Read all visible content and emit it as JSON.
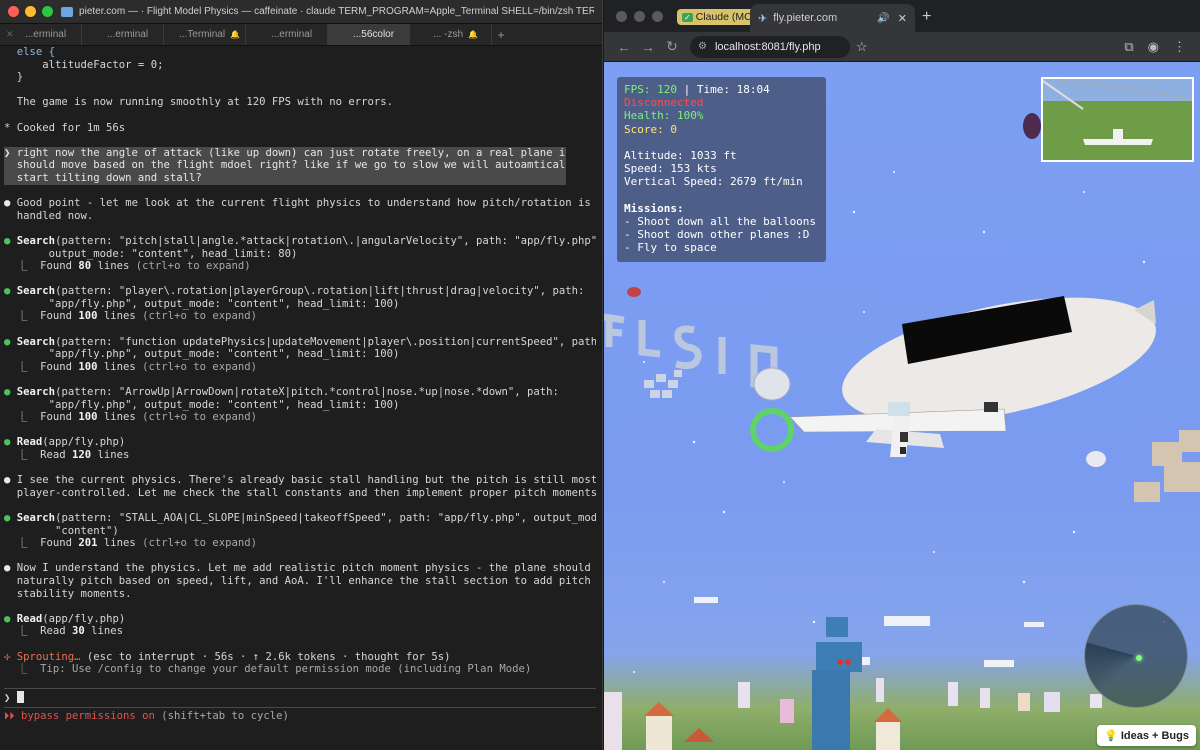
{
  "terminal": {
    "window_title": "pieter.com — · Flight Model Physics — caffeinate · claude TERM_PROGRAM=Apple_Terminal SHELL=/bin/zsh TERM=xter...",
    "tabs": [
      {
        "label": "...erminal",
        "active": false
      },
      {
        "label": "...erminal",
        "active": false
      },
      {
        "label": "...Terminal",
        "active": false
      },
      {
        "label": "...erminal",
        "active": false
      },
      {
        "label": "...56color",
        "active": true
      },
      {
        "label": "... -zsh",
        "active": false
      }
    ],
    "lines": {
      "l01": "  else {",
      "l02": "      altitudeFactor = 0;",
      "l03": "  }",
      "l05": "  The game is now running smoothly at 120 FPS with no errors.",
      "l07": "* Cooked for 1m 56s",
      "user_1": "❯ right now the angle of attack (like up down) can just rotate freely, on a real plane it",
      "user_2": "  should move based on the flight mdoel right? like if we go to slow we will autoamtically",
      "user_3": "  start tilting down and stall?",
      "a1_1": " Good point - let me look at the current flight physics to understand how pitch/rotation is",
      "a1_2": "  handled now.",
      "s1_tool": "Search",
      "s1_1": "(pattern: \"pitch|stall|angle.*attack|rotation\\.|angularVelocity\", path: \"app/fly.php\",",
      "s1_2": "       output_mode: \"content\", head_limit: 80)",
      "s1_found": "80",
      "s2_tool": "Search",
      "s2_1": "(pattern: \"player\\.rotation|playerGroup\\.rotation|lift|thrust|drag|velocity\", path:",
      "s2_2": "       \"app/fly.php\", output_mode: \"content\", head_limit: 100)",
      "s2_found": "100",
      "s3_tool": "Search",
      "s3_1": "(pattern: \"function updatePhysics|updateMovement|player\\.position|currentSpeed\", path:",
      "s3_2": "       \"app/fly.php\", output_mode: \"content\", head_limit: 100)",
      "s3_found": "100",
      "s4_tool": "Search",
      "s4_1": "(pattern: \"ArrowUp|ArrowDown|rotateX|pitch.*control|nose.*up|nose.*down\", path:",
      "s4_2": "       \"app/fly.php\", output_mode: \"content\", head_limit: 100)",
      "s4_found": "100",
      "r1_tool": "Read",
      "r1_args": "(app/fly.php)",
      "r1_count": "120",
      "a2_1": " I see the current physics. There's already basic stall handling but the pitch is still mostly",
      "a2_2": "  player-controlled. Let me check the stall constants and then implement proper pitch moments.",
      "s5_tool": "Search",
      "s5_1": "(pattern: \"STALL_AOA|CL_SLOPE|minSpeed|takeoffSpeed\", path: \"app/fly.php\", output_mode:",
      "s5_2": "        \"content\")",
      "s5_found": "201",
      "a3_1": " Now I understand the physics. Let me add realistic pitch moment physics - the plane should",
      "a3_2": "  naturally pitch based on speed, lift, and AoA. I'll enhance the stall section to add pitch",
      "a3_3": "  stability moments.",
      "r2_tool": "Read",
      "r2_args": "(app/fly.php)",
      "r2_count": "30",
      "found_prefix": "  ⎿  Found ",
      "found_suffix": " lines ",
      "expand_hint": "(ctrl+o to expand)",
      "read_prefix": "  ⎿  Read ",
      "read_suffix": " lines",
      "status_spinner": "✢ Sprouting…",
      "status_rest": " (esc to interrupt · 56s · ↑ 2.6k tokens · thought for 5s)",
      "status_esc": "esc",
      "tip": "  ⎿  Tip: Use /config to change your default permission mode (including Plan Mode)",
      "prompt": "❯ ",
      "bypass_arrows": "⏵⏵ ",
      "bypass_label": "bypass permissions on",
      "bypass_hint": " (shift+tab to cycle)"
    }
  },
  "browser": {
    "tabs": {
      "claude_badge": "Claude (MCP)",
      "active_title": "fly.pieter.com"
    },
    "url": "localhost:8081/fly.php",
    "hud": {
      "fps_label": "FPS: 120",
      "time_label": " | Time: 18:04",
      "connection": "Disconnected",
      "health": "Health: 100%",
      "score": "Score: 0",
      "altitude": "Altitude: 1033 ft",
      "speed": "Speed: 153 kts",
      "vertical_speed": "Vertical Speed: 2679 ft/min",
      "missions_title": "Missions:",
      "missions": [
        "- Shoot down all the balloons",
        "- Shoot down other planes :D",
        "- Fly to space"
      ]
    },
    "feedback_label": "Ideas + Bugs",
    "colors": {
      "hud_green": "#7cf07c",
      "hud_red": "#ff4d4d",
      "sky": "#7c9ef3"
    }
  }
}
